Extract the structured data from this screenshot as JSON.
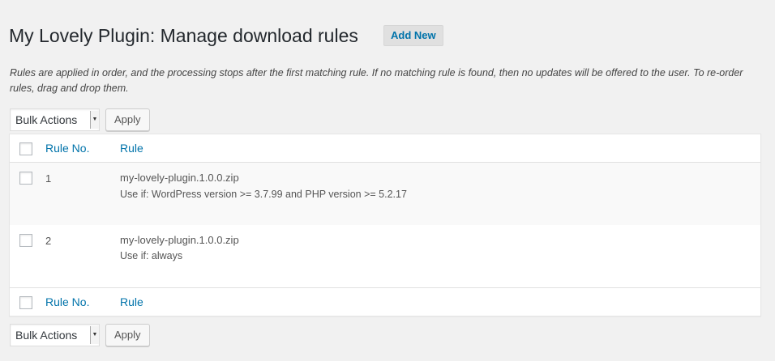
{
  "page": {
    "title": "My Lovely Plugin: Manage download rules",
    "add_new_label": "Add New",
    "description": "Rules are applied in order, and the processing stops after the first matching rule. If no matching rule is found, then no updates will be offered to the user. To re-order rules, drag and drop them."
  },
  "tablenav": {
    "bulk_actions_selected": "Bulk Actions",
    "apply_label": "Apply"
  },
  "table": {
    "columns": [
      "Rule No.",
      "Rule"
    ],
    "rows": [
      {
        "number": "1",
        "file": "my-lovely-plugin.1.0.0.zip",
        "condition": "Use if: WordPress version >= 3.7.99 and PHP version >= 5.2.17"
      },
      {
        "number": "2",
        "file": "my-lovely-plugin.1.0.0.zip",
        "condition": "Use if: always"
      }
    ]
  },
  "colors": {
    "link": "#0073aa",
    "background": "#f1f1f1",
    "alt_row": "#f9f9f9"
  },
  "icons": [
    "dropdown-arrow-icon",
    "checkbox-icon"
  ]
}
